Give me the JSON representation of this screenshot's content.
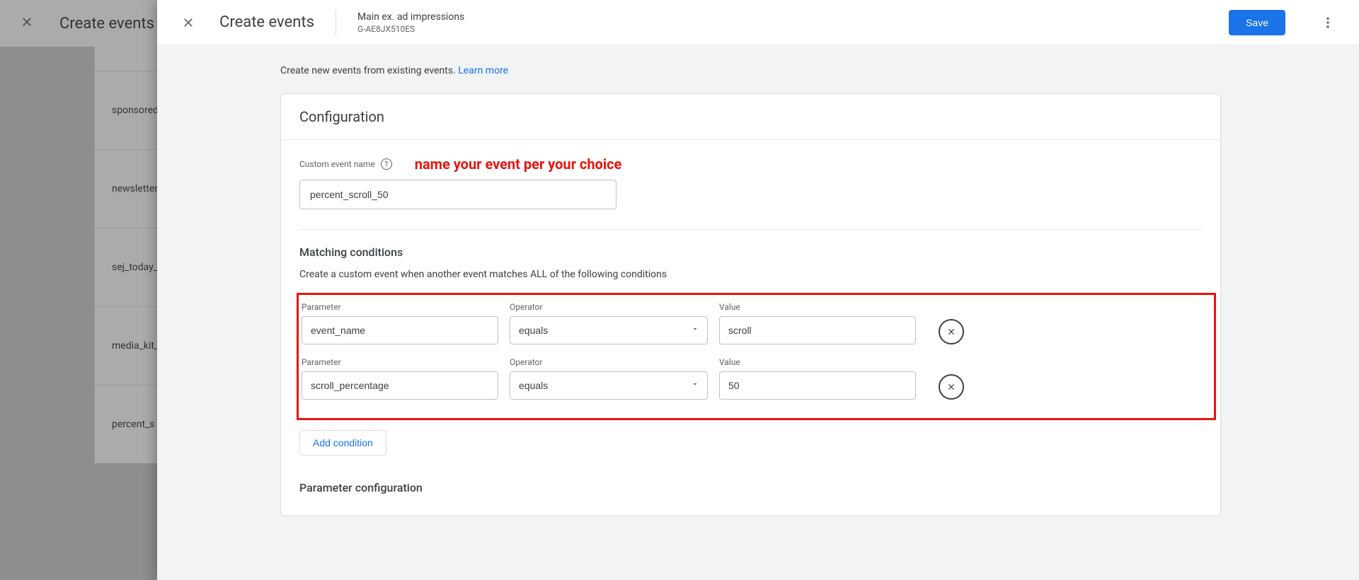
{
  "background": {
    "title": "Create events",
    "items": [
      "sponsored",
      "newsletter",
      "sej_today_",
      "media_kit_",
      "percent_s"
    ]
  },
  "panel": {
    "title": "Create events",
    "breadcrumb": {
      "main": "Main ex. ad impressions",
      "sub": "G-AE8JX510ES"
    },
    "save": "Save",
    "intro_text": "Create new events from existing events. ",
    "learn_more": "Learn more"
  },
  "config": {
    "card_title": "Configuration",
    "custom_name_label": "Custom event name",
    "custom_name_value": "percent_scroll_50",
    "annotation": "name your event per your choice",
    "matching_title": "Matching conditions",
    "matching_sub": "Create a custom event when another event matches ALL of the following conditions",
    "labels": {
      "parameter": "Parameter",
      "operator": "Operator",
      "value": "Value"
    },
    "conditions": [
      {
        "parameter": "event_name",
        "operator": "equals",
        "value": "scroll"
      },
      {
        "parameter": "scroll_percentage",
        "operator": "equals",
        "value": "50"
      }
    ],
    "add_condition": "Add condition",
    "param_config_title": "Parameter configuration"
  }
}
